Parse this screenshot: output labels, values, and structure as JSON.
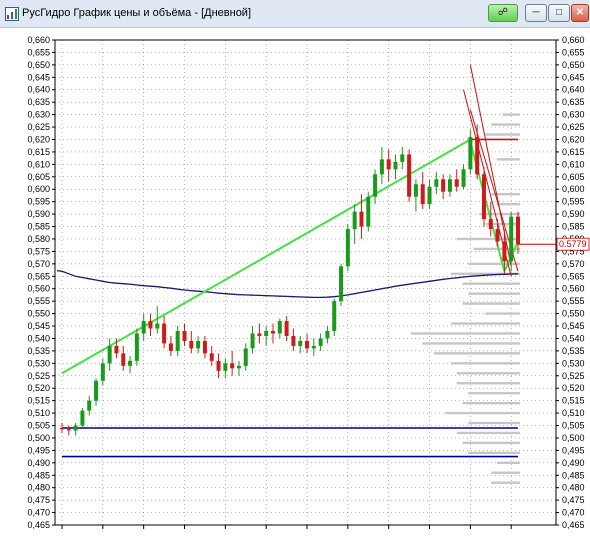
{
  "window": {
    "title": "РусГидро График цены и объёма - [Дневной]",
    "buttons": [
      {
        "name": "link",
        "icon": "link-icon"
      },
      {
        "name": "minimize",
        "icon": "minimize-icon"
      },
      {
        "name": "maximize",
        "icon": "maximize-icon"
      },
      {
        "name": "close",
        "icon": "close-icon"
      }
    ]
  },
  "colors": {
    "up_candle": "#1a9a1a",
    "down_candle": "#d01a1a",
    "trend_line": "#44e044",
    "moving_average": "#1a1a6e",
    "volume_profile": "#c6c6c6",
    "grid": "#000000",
    "support_line": "#000080",
    "resistance_line": "#c81010",
    "last_price": "#c00000"
  },
  "last_price_label": "0.5779",
  "chart_data": {
    "type": "candlestick",
    "title": "",
    "y_axis_labels": [
      "0,660",
      "0,655",
      "0,650",
      "0,645",
      "0,640",
      "0,635",
      "0,630",
      "0,625",
      "0,620",
      "0,615",
      "0,610",
      "0,605",
      "0,600",
      "0,595",
      "0,590",
      "0,585",
      "0,580",
      "0,575",
      "0,570",
      "0,565",
      "0,560",
      "0,555",
      "0,550",
      "0,545",
      "0,540",
      "0,535",
      "0,530",
      "0,525",
      "0,520",
      "0,515",
      "0,510",
      "0,505",
      "0,500",
      "0,495",
      "0,490",
      "0,485",
      "0,480",
      "0,475",
      "0,470",
      "0,465"
    ],
    "ylim": [
      0.4625,
      0.6625
    ],
    "grid": true,
    "candles": [
      {
        "o": 0.504,
        "h": 0.506,
        "l": 0.502,
        "c": 0.5035
      },
      {
        "o": 0.5035,
        "h": 0.505,
        "l": 0.501,
        "c": 0.503
      },
      {
        "o": 0.503,
        "h": 0.506,
        "l": 0.501,
        "c": 0.505
      },
      {
        "o": 0.505,
        "h": 0.512,
        "l": 0.504,
        "c": 0.511
      },
      {
        "o": 0.511,
        "h": 0.517,
        "l": 0.509,
        "c": 0.515
      },
      {
        "o": 0.515,
        "h": 0.524,
        "l": 0.513,
        "c": 0.523
      },
      {
        "o": 0.523,
        "h": 0.532,
        "l": 0.521,
        "c": 0.53
      },
      {
        "o": 0.53,
        "h": 0.54,
        "l": 0.527,
        "c": 0.537
      },
      {
        "o": 0.537,
        "h": 0.54,
        "l": 0.532,
        "c": 0.534
      },
      {
        "o": 0.534,
        "h": 0.537,
        "l": 0.527,
        "c": 0.529
      },
      {
        "o": 0.529,
        "h": 0.533,
        "l": 0.526,
        "c": 0.531
      },
      {
        "o": 0.531,
        "h": 0.544,
        "l": 0.529,
        "c": 0.542
      },
      {
        "o": 0.542,
        "h": 0.55,
        "l": 0.539,
        "c": 0.547
      },
      {
        "o": 0.547,
        "h": 0.55,
        "l": 0.541,
        "c": 0.544
      },
      {
        "o": 0.544,
        "h": 0.553,
        "l": 0.542,
        "c": 0.546
      },
      {
        "o": 0.546,
        "h": 0.549,
        "l": 0.536,
        "c": 0.538
      },
      {
        "o": 0.538,
        "h": 0.541,
        "l": 0.533,
        "c": 0.535
      },
      {
        "o": 0.535,
        "h": 0.545,
        "l": 0.533,
        "c": 0.543
      },
      {
        "o": 0.543,
        "h": 0.546,
        "l": 0.537,
        "c": 0.539
      },
      {
        "o": 0.539,
        "h": 0.543,
        "l": 0.534,
        "c": 0.536
      },
      {
        "o": 0.536,
        "h": 0.541,
        "l": 0.534,
        "c": 0.539
      },
      {
        "o": 0.539,
        "h": 0.541,
        "l": 0.532,
        "c": 0.534
      },
      {
        "o": 0.534,
        "h": 0.537,
        "l": 0.529,
        "c": 0.531
      },
      {
        "o": 0.531,
        "h": 0.534,
        "l": 0.524,
        "c": 0.527
      },
      {
        "o": 0.527,
        "h": 0.532,
        "l": 0.524,
        "c": 0.53
      },
      {
        "o": 0.53,
        "h": 0.535,
        "l": 0.525,
        "c": 0.528
      },
      {
        "o": 0.528,
        "h": 0.531,
        "l": 0.525,
        "c": 0.529
      },
      {
        "o": 0.529,
        "h": 0.538,
        "l": 0.527,
        "c": 0.536
      },
      {
        "o": 0.536,
        "h": 0.545,
        "l": 0.534,
        "c": 0.542
      },
      {
        "o": 0.542,
        "h": 0.546,
        "l": 0.538,
        "c": 0.541
      },
      {
        "o": 0.541,
        "h": 0.545,
        "l": 0.537,
        "c": 0.543
      },
      {
        "o": 0.543,
        "h": 0.546,
        "l": 0.538,
        "c": 0.542
      },
      {
        "o": 0.542,
        "h": 0.548,
        "l": 0.54,
        "c": 0.547
      },
      {
        "o": 0.547,
        "h": 0.549,
        "l": 0.539,
        "c": 0.541
      },
      {
        "o": 0.541,
        "h": 0.544,
        "l": 0.535,
        "c": 0.537
      },
      {
        "o": 0.537,
        "h": 0.541,
        "l": 0.534,
        "c": 0.539
      },
      {
        "o": 0.539,
        "h": 0.542,
        "l": 0.534,
        "c": 0.536
      },
      {
        "o": 0.536,
        "h": 0.54,
        "l": 0.533,
        "c": 0.537
      },
      {
        "o": 0.537,
        "h": 0.542,
        "l": 0.535,
        "c": 0.54
      },
      {
        "o": 0.54,
        "h": 0.545,
        "l": 0.538,
        "c": 0.543
      },
      {
        "o": 0.543,
        "h": 0.556,
        "l": 0.541,
        "c": 0.555
      },
      {
        "o": 0.555,
        "h": 0.57,
        "l": 0.553,
        "c": 0.569
      },
      {
        "o": 0.569,
        "h": 0.586,
        "l": 0.567,
        "c": 0.584
      },
      {
        "o": 0.584,
        "h": 0.594,
        "l": 0.578,
        "c": 0.591
      },
      {
        "o": 0.591,
        "h": 0.598,
        "l": 0.58,
        "c": 0.585
      },
      {
        "o": 0.585,
        "h": 0.599,
        "l": 0.583,
        "c": 0.597
      },
      {
        "o": 0.597,
        "h": 0.608,
        "l": 0.594,
        "c": 0.606
      },
      {
        "o": 0.606,
        "h": 0.617,
        "l": 0.602,
        "c": 0.612
      },
      {
        "o": 0.612,
        "h": 0.616,
        "l": 0.603,
        "c": 0.608
      },
      {
        "o": 0.608,
        "h": 0.614,
        "l": 0.604,
        "c": 0.611
      },
      {
        "o": 0.611,
        "h": 0.617,
        "l": 0.608,
        "c": 0.614
      },
      {
        "o": 0.614,
        "h": 0.616,
        "l": 0.595,
        "c": 0.597
      },
      {
        "o": 0.597,
        "h": 0.604,
        "l": 0.591,
        "c": 0.602
      },
      {
        "o": 0.602,
        "h": 0.607,
        "l": 0.592,
        "c": 0.594
      },
      {
        "o": 0.594,
        "h": 0.604,
        "l": 0.592,
        "c": 0.601
      },
      {
        "o": 0.601,
        "h": 0.607,
        "l": 0.598,
        "c": 0.604
      },
      {
        "o": 0.604,
        "h": 0.606,
        "l": 0.596,
        "c": 0.599
      },
      {
        "o": 0.599,
        "h": 0.606,
        "l": 0.597,
        "c": 0.604
      },
      {
        "o": 0.604,
        "h": 0.608,
        "l": 0.599,
        "c": 0.601
      },
      {
        "o": 0.601,
        "h": 0.61,
        "l": 0.6,
        "c": 0.608
      },
      {
        "o": 0.608,
        "h": 0.624,
        "l": 0.606,
        "c": 0.621
      },
      {
        "o": 0.621,
        "h": 0.626,
        "l": 0.604,
        "c": 0.606
      },
      {
        "o": 0.606,
        "h": 0.609,
        "l": 0.585,
        "c": 0.588
      },
      {
        "o": 0.588,
        "h": 0.595,
        "l": 0.581,
        "c": 0.584
      },
      {
        "o": 0.584,
        "h": 0.588,
        "l": 0.577,
        "c": 0.579
      },
      {
        "o": 0.579,
        "h": 0.584,
        "l": 0.566,
        "c": 0.571
      },
      {
        "o": 0.571,
        "h": 0.591,
        "l": 0.567,
        "c": 0.589
      },
      {
        "o": 0.589,
        "h": 0.591,
        "l": 0.574,
        "c": 0.578
      }
    ],
    "moving_average": [
      0.567,
      0.566,
      0.565,
      0.5645,
      0.564,
      0.5635,
      0.563,
      0.5625,
      0.5622,
      0.562,
      0.5618,
      0.5615,
      0.5612,
      0.561,
      0.5608,
      0.5605,
      0.5602,
      0.5598,
      0.5595,
      0.5592,
      0.559,
      0.5588,
      0.5585,
      0.5582,
      0.558,
      0.5578,
      0.5576,
      0.5575,
      0.5574,
      0.5573,
      0.5572,
      0.5571,
      0.557,
      0.5569,
      0.5568,
      0.5567,
      0.5566,
      0.5565,
      0.5565,
      0.5566,
      0.5568,
      0.5571,
      0.5575,
      0.558,
      0.5585,
      0.559,
      0.5595,
      0.56,
      0.5605,
      0.561,
      0.5614,
      0.5618,
      0.5622,
      0.5626,
      0.563,
      0.5634,
      0.5638,
      0.5641,
      0.5644,
      0.5647,
      0.565,
      0.5652,
      0.5654,
      0.5656,
      0.5657,
      0.5658,
      0.5659,
      0.566
    ],
    "trend_lines": [
      {
        "from": [
          0,
          0.526
        ],
        "to": [
          60,
          0.62
        ],
        "color": "trend_line"
      },
      {
        "from": [
          60,
          0.619
        ],
        "to": [
          65,
          0.567
        ],
        "color": "trend_line"
      },
      {
        "from": [
          65,
          0.567
        ],
        "to": [
          67,
          0.579
        ],
        "color": "trend_line"
      },
      {
        "from": [
          59,
          0.64
        ],
        "to": [
          66,
          0.565
        ],
        "color": "resistance_line"
      },
      {
        "from": [
          60,
          0.65
        ],
        "to": [
          66,
          0.569
        ],
        "color": "resistance_line"
      },
      {
        "from": [
          60,
          0.632
        ],
        "to": [
          67,
          0.567
        ],
        "color": "resistance_line"
      }
    ],
    "horizontal_lines": [
      {
        "price": 0.62,
        "from": 60,
        "to": 67,
        "color": "resistance_line"
      },
      {
        "price": 0.504,
        "from": 0,
        "to": 67,
        "color": "support_line"
      },
      {
        "price": 0.4925,
        "from": 0,
        "to": 67,
        "color": "support_line"
      }
    ],
    "volume_profile": [
      {
        "price": 0.63,
        "w": 0.15
      },
      {
        "price": 0.626,
        "w": 0.25
      },
      {
        "price": 0.622,
        "w": 0.3
      },
      {
        "price": 0.612,
        "w": 0.2
      },
      {
        "price": 0.598,
        "w": 0.25
      },
      {
        "price": 0.594,
        "w": 0.2
      },
      {
        "price": 0.59,
        "w": 0.35
      },
      {
        "price": 0.586,
        "w": 0.3
      },
      {
        "price": 0.58,
        "w": 0.55
      },
      {
        "price": 0.576,
        "w": 0.4
      },
      {
        "price": 0.57,
        "w": 0.45
      },
      {
        "price": 0.566,
        "w": 0.6
      },
      {
        "price": 0.562,
        "w": 0.5
      },
      {
        "price": 0.558,
        "w": 0.45
      },
      {
        "price": 0.554,
        "w": 0.5
      },
      {
        "price": 0.55,
        "w": 0.3
      },
      {
        "price": 0.546,
        "w": 0.6
      },
      {
        "price": 0.542,
        "w": 0.95
      },
      {
        "price": 0.538,
        "w": 0.85
      },
      {
        "price": 0.534,
        "w": 0.75
      },
      {
        "price": 0.53,
        "w": 0.6
      },
      {
        "price": 0.526,
        "w": 0.55
      },
      {
        "price": 0.522,
        "w": 0.55
      },
      {
        "price": 0.518,
        "w": 0.45
      },
      {
        "price": 0.514,
        "w": 0.5
      },
      {
        "price": 0.51,
        "w": 0.65
      },
      {
        "price": 0.506,
        "w": 0.45
      },
      {
        "price": 0.502,
        "w": 0.55
      },
      {
        "price": 0.498,
        "w": 0.5
      },
      {
        "price": 0.494,
        "w": 0.45
      },
      {
        "price": 0.49,
        "w": 0.2
      },
      {
        "price": 0.486,
        "w": 0.25
      },
      {
        "price": 0.482,
        "w": 0.25
      }
    ]
  }
}
